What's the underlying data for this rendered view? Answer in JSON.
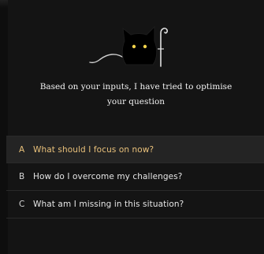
{
  "prompt": {
    "line1": "Based on your inputs, I have tried to optimise",
    "line2": "your question"
  },
  "options": [
    {
      "letter": "A",
      "text": "What should I focus on now?",
      "selected": true
    },
    {
      "letter": "B",
      "text": "How do I overcome my challenges?",
      "selected": false
    },
    {
      "letter": "C",
      "text": "What am I missing in this situation?",
      "selected": false
    }
  ],
  "icons": {
    "mascot": "black-cat-with-cane-icon"
  },
  "colors": {
    "background": "#0e0e0e",
    "panel": "#141414",
    "selected_row": "#242424",
    "accent_text": "#e8c07a",
    "cat_eyes": "#f2d34b"
  }
}
